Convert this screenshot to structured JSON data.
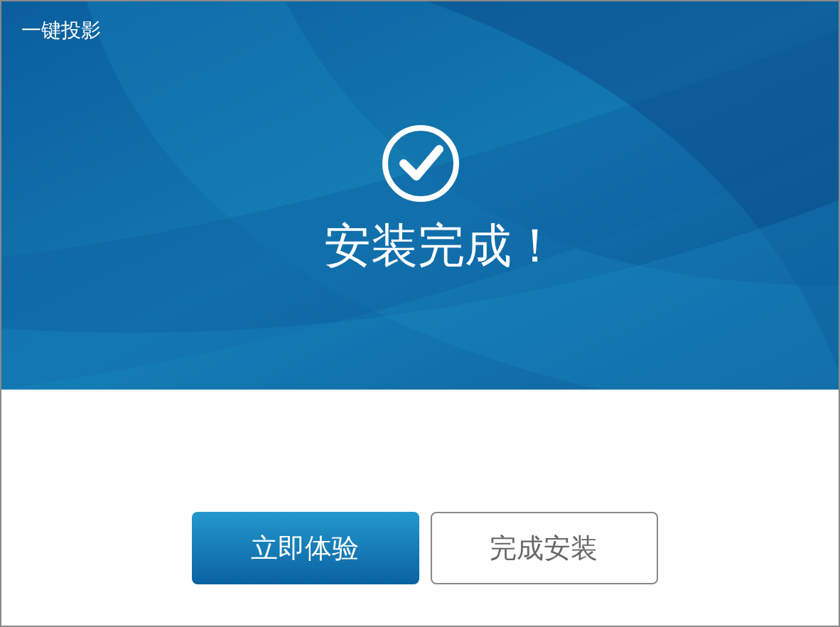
{
  "window": {
    "title": "一键投影"
  },
  "status": {
    "message": "安装完成！"
  },
  "buttons": [
    {
      "label": "立即体验",
      "kind": "primary"
    },
    {
      "label": "完成安装",
      "kind": "secondary"
    }
  ]
}
